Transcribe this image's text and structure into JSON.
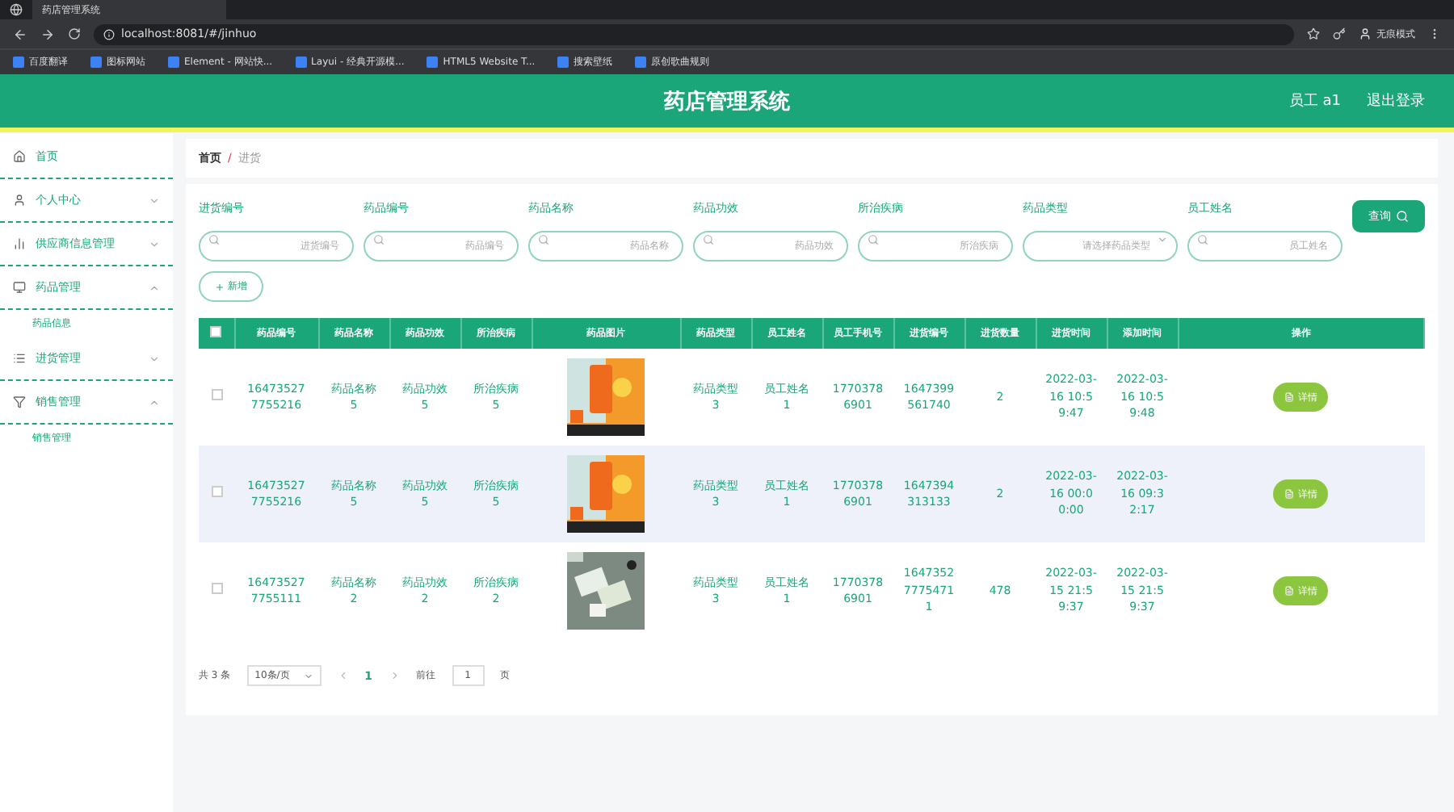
{
  "browser": {
    "tab_title": "药店管理系统",
    "url": "localhost:8081/#/jinhuo",
    "profile": "无痕模式",
    "bookmarks": [
      "百度翻译",
      "图标网站",
      "Element - 网站快...",
      "Layui - 经典开源模...",
      "HTML5 Website T...",
      "搜索壁纸",
      "原创歌曲规则"
    ]
  },
  "header": {
    "title": "药店管理系统",
    "user": "员工 a1",
    "logout": "退出登录"
  },
  "sidebar": {
    "items": [
      {
        "label": "首页"
      },
      {
        "label": "个人中心",
        "expanded": false
      },
      {
        "label": "供应商信息管理",
        "expanded": false
      },
      {
        "label": "药品管理",
        "expanded": true,
        "children": [
          {
            "label": "药品信息"
          }
        ]
      },
      {
        "label": "进货管理",
        "expanded": false
      },
      {
        "label": "销售管理",
        "expanded": true,
        "children": [
          {
            "label": "销售管理"
          }
        ]
      }
    ]
  },
  "breadcrumb": {
    "items": [
      "首页",
      "进货"
    ],
    "separator": "/"
  },
  "filters": [
    {
      "label": "进货编号",
      "placeholder": "进货编号",
      "kind": "input"
    },
    {
      "label": "药品编号",
      "placeholder": "药品编号",
      "kind": "input"
    },
    {
      "label": "药品名称",
      "placeholder": "药品名称",
      "kind": "input"
    },
    {
      "label": "药品功效",
      "placeholder": "药品功效",
      "kind": "input"
    },
    {
      "label": "所治疾病",
      "placeholder": "所治疾病",
      "kind": "input"
    },
    {
      "label": "药品类型",
      "placeholder": "请选择药品类型",
      "kind": "select"
    },
    {
      "label": "员工姓名",
      "placeholder": "员工姓名",
      "kind": "input"
    }
  ],
  "search_button": "查询",
  "add_button": "新增",
  "table": {
    "header_checked": false,
    "columns": [
      "药品编号",
      "药品名称",
      "药品功效",
      "所治疾病",
      "药品图片",
      "药品类型",
      "员工姓名",
      "员工手机号",
      "进货编号",
      "进货数量",
      "进货时间",
      "添加时间",
      "操作"
    ],
    "rows": [
      {
        "checked": false,
        "highlighted": false,
        "cells": [
          "164735277755216",
          "药品名称5",
          "药品功效5",
          "所治疾病5",
          null,
          "药品类型3",
          "员工姓名1",
          "17703786901",
          "1647399561740",
          "2",
          "2022-03-16 10:59:47",
          "2022-03-16 10:59:48"
        ],
        "action": "详情"
      },
      {
        "checked": false,
        "highlighted": true,
        "cells": [
          "164735277755216",
          "药品名称5",
          "药品功效5",
          "所治疾病5",
          null,
          "药品类型3",
          "员工姓名1",
          "17703786901",
          "1647394313133",
          "2",
          "2022-03-16 00:00:00",
          "2022-03-16 09:32:17"
        ],
        "action": "详情"
      },
      {
        "checked": false,
        "highlighted": false,
        "cells": [
          "164735277755111",
          "药品名称2",
          "药品功效2",
          "所治疾病2",
          null,
          "药品类型3",
          "员工姓名1",
          "17703786901",
          "164735277754711",
          "478",
          "2022-03-15 21:59:37",
          "2022-03-15 21:59:37"
        ],
        "action": "详情"
      }
    ]
  },
  "pagination": {
    "total": "共 3 条",
    "page_size": "10条/页",
    "pages": [
      {
        "label": "1",
        "selected": true
      }
    ],
    "goto": "前往",
    "goto_value": "1",
    "page_unit": "页"
  }
}
